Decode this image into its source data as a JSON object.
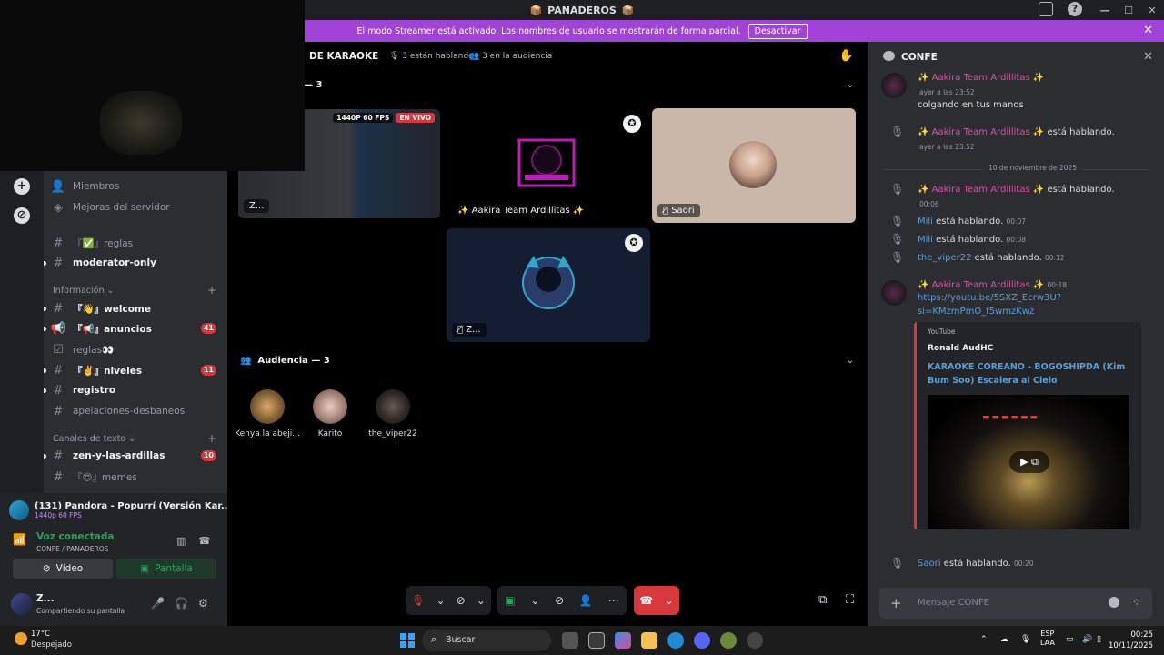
{
  "app": {
    "title": "PANADEROS",
    "streamer_banner": "El modo Streamer está activado. Los nombres de usuario se mostrarán de forma parcial.",
    "deactivate_label": "Desactivar"
  },
  "sidebar": {
    "top_items": [
      {
        "label": "Miembros"
      },
      {
        "label": "Mejoras del servidor"
      }
    ],
    "channels_top": [
      {
        "label": "『✅』reglas",
        "unread": false
      },
      {
        "label": "moderator-only",
        "unread": true
      }
    ],
    "cat_info": "Información",
    "channels_info": [
      {
        "label": "『👋』welcome",
        "badge": ""
      },
      {
        "label": "『📢』anuncios",
        "badge": "41"
      },
      {
        "label": "reglas👀",
        "badge": ""
      },
      {
        "label": "『✌️』niveles",
        "badge": "11"
      },
      {
        "label": "registro",
        "badge": ""
      },
      {
        "label": "apelaciones-desbaneos",
        "badge": ""
      }
    ],
    "cat_text": "Canales de texto",
    "channels_text": [
      {
        "label": "zen-y-las-ardillas",
        "badge": "10"
      },
      {
        "label": "『😍』memes",
        "badge": ""
      }
    ]
  },
  "panel": {
    "stream_title": "(131) Pandora - Popurrí (Versión Kar...",
    "stream_quality": "1440p 60 FPS",
    "voice_status": "Voz conectada",
    "voice_location": "CONFE / PANADEROS",
    "video_label": "Vídeo",
    "screen_label": "Pantalla",
    "user_name": "Z...",
    "user_status": "Compartiendo su pantalla"
  },
  "stage": {
    "channel_name": "DE KARAOKE",
    "speaking": "3 están hablando",
    "audience_count": "3 en la audiencia",
    "speakers_title": "— 3",
    "tiles": [
      {
        "caption": "Z...",
        "quality": "1440P 60 FPS",
        "live": "EN VIVO"
      },
      {
        "caption": "✨ Aakira Team Ardillitas ✨"
      },
      {
        "caption": "Saori"
      },
      {
        "caption": "Z..."
      }
    ],
    "audience_title": "Audiencia — 3",
    "audience": [
      {
        "name": "Kenya la abeji..."
      },
      {
        "name": "Karito"
      },
      {
        "name": "the_viper22"
      }
    ]
  },
  "chat": {
    "title": "CONFE",
    "close": "✕",
    "messages": {
      "m1_author": "✨ Aakira Team Ardillitas ✨",
      "m1_ts": "ayer a las 23:52",
      "m1_text": "colgando en tus manos",
      "m2_author": "✨ Aakira Team Ardillitas ✨",
      "m2_text": "está hablando.",
      "m2_ts": "ayer a las 23:52",
      "date_divider": "10 de noviembre de 2025",
      "m3_author": "✨ Aakira Team Ardillitas ✨",
      "m3_text": "está hablando.",
      "m3_ts": "00:06",
      "m4_author": "Mili",
      "m4_text": "está hablando.",
      "m4_ts": "00:07",
      "m5_author": "Mili",
      "m5_text": "está hablando.",
      "m5_ts": "00:08",
      "m6_author": "the_viper22",
      "m6_text": "está hablando.",
      "m6_ts": "00:12",
      "m7_author": "✨ Aakira Team Ardillitas ✨",
      "m7_ts": "00:18",
      "m7_link1": "https://youtu.be/5SXZ_Ecrw3U?",
      "m7_link2": "si=KMzmPmO_f5wmzKwz",
      "m8_author": "Saori",
      "m8_text": "está hablando.",
      "m8_ts": "00:20"
    },
    "embed": {
      "provider": "YouTube",
      "author": "Ronald AudHC",
      "title": "KARAOKE COREANO - BOGOSHIPDA (Kim Bum Soo) Escalera al Cielo"
    },
    "input_placeholder": "Mensaje CONFE"
  },
  "taskbar": {
    "temp": "17°C",
    "weather": "Despejado",
    "search": "Buscar",
    "lang1": "ESP",
    "lang2": "LAA",
    "time": "00:25",
    "date": "10/11/2025"
  },
  "colors": {
    "banner": "#a043d6",
    "accent_green": "#23a55a",
    "hangup": "#da373c",
    "link": "#5b9fd9",
    "pink_name": "#e24ba8"
  }
}
